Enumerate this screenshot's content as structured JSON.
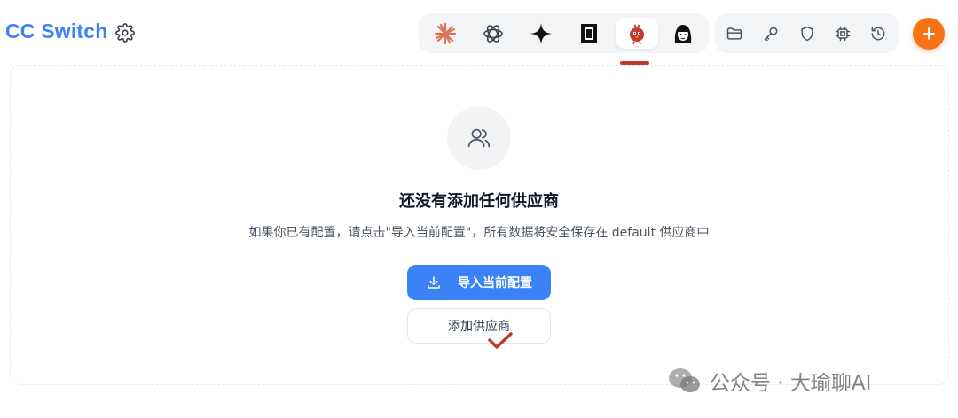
{
  "header": {
    "title": "CC Switch",
    "apps": [
      {
        "name": "claude",
        "icon": "claude-sunburst-icon",
        "active": false
      },
      {
        "name": "openai",
        "icon": "openai-knot-icon",
        "active": false
      },
      {
        "name": "gemini",
        "icon": "gemini-sparkle-icon",
        "active": false
      },
      {
        "name": "square",
        "icon": "square-frame-icon",
        "active": false
      },
      {
        "name": "red-bird",
        "icon": "red-bird-icon",
        "active": true
      },
      {
        "name": "face",
        "icon": "cartoon-face-icon",
        "active": false
      }
    ],
    "tools": [
      "folder-icon",
      "key-icon",
      "shield-icon",
      "cpu-chip-icon",
      "history-icon"
    ],
    "accent": "#3b82f6",
    "add_color": "#f97316"
  },
  "empty_state": {
    "title": "还没有添加任何供应商",
    "description": "如果你已有配置，请点击\"导入当前配置\"，所有数据将安全保存在 default 供应商中",
    "import_label": "导入当前配置",
    "add_label": "添加供应商"
  },
  "watermark": {
    "text": "公众号 · 大瑜聊AI"
  }
}
